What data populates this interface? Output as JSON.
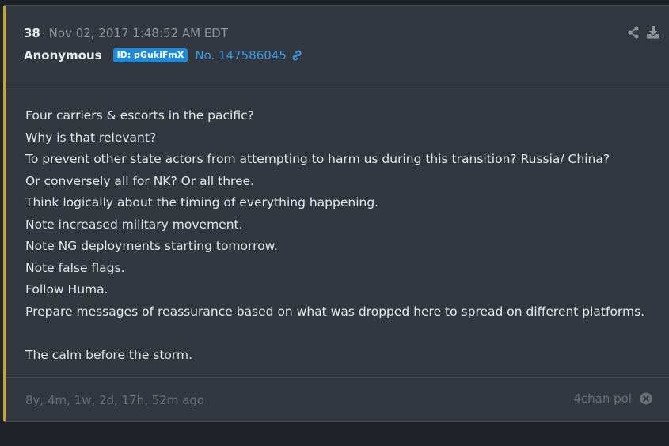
{
  "post": {
    "number": "38",
    "timestamp": "Nov 02, 2017 1:48:52 AM EDT",
    "author": "Anonymous",
    "id_badge": "ID: pGukiFmX",
    "post_no": "No. 147586045",
    "lines": [
      "Four carriers & escorts in the pacific?",
      "Why is that relevant?",
      "To prevent other state actors from attempting to harm us during this transition? Russia/ China?",
      "Or conversely all for NK? Or all three.",
      "Think logically about the timing of everything happening.",
      "Note increased military movement.",
      "Note NG deployments starting tomorrow.",
      "Note false flags.",
      "Follow Huma.",
      "Prepare messages of reassurance based on what was dropped here to spread on different platforms.",
      "",
      "The calm before the storm."
    ],
    "ago": "8y, 4m, 1w, 2d, 17h, 52m ago",
    "source": "4chan pol"
  },
  "icons": {
    "share": "share-icon",
    "download": "download-icon",
    "link": "link-icon",
    "close": "close-circle-icon"
  },
  "colors": {
    "accent": "#c9a227",
    "link": "#3a9ae6",
    "badge": "#1f8ad8"
  }
}
